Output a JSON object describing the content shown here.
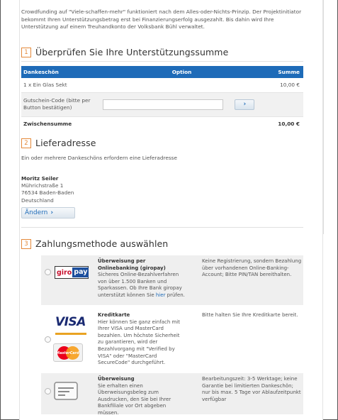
{
  "intro_text": "Crowdfunding auf \"Viele-schaffen-mehr\" funktioniert nach dem Alles-oder-Nichts-Prinzip. Der Projektinitiator bekommt Ihren Unterstützungsbetrag erst bei Finanzierungserfolg ausgezahlt. Bis dahin wird Ihre Unterstützung auf einem Treuhandkonto der Volksbank Bühl verwaltet.",
  "sections": {
    "summary": {
      "number": "1",
      "title": "Überprüfen Sie Ihre Unterstützungssumme"
    },
    "delivery": {
      "number": "2",
      "title": "Lieferadresse"
    },
    "payment": {
      "number": "3",
      "title": "Zahlungsmethode auswählen"
    }
  },
  "summary_table": {
    "headers": [
      "Dankeschön",
      "Option",
      "Summe"
    ],
    "item": {
      "label": "1 x Ein Glas Sekt",
      "amount": "10,00 €"
    },
    "voucher": {
      "label": "Gutschein-Code (bitte per Button bestätigen)",
      "value": "",
      "button": "›"
    },
    "subtotal": {
      "label": "Zwischensumme",
      "amount": "10,00 €"
    }
  },
  "delivery": {
    "note": "Ein oder mehrere Dankeschöns erfordern eine Lieferadresse",
    "name": "Moritz Seiler",
    "street": "Mührichstraße 1",
    "city": "76534 Baden-Baden",
    "country": "Deutschland",
    "change_button": "Ändern",
    "change_chevron": "›"
  },
  "payment_methods": [
    {
      "logo_text_1": "giro",
      "logo_text_2": "pay",
      "title": "Überweisung per Onlinebanking (giropay)",
      "description_pre": "Sicheres Online-Bezahlverfahren von über 1.500 Banken und Sparkassen. Ob Ihre Bank giropay unterstützt können Sie ",
      "link": "hier",
      "description_post": " prüfen.",
      "note": "Keine Registrierung, sondern Bezahlung über vorhandenen Online-Banking- Account; Bitte PIN/TAN bereithalten."
    },
    {
      "logo_visa": "VISA",
      "logo_mc": "MasterCard",
      "title": "Kreditkarte",
      "description": "Hier können Sie ganz einfach mit Ihrer VISA und MasterCard bezahlen. Um höchste Sicherheit zu garantieren, wird der Bezahlvorgang mit \"Verified by VISA\" oder \"MasterCard SecureCode\" durchgeführt.",
      "note": "Bitte halten Sie Ihre Kreditkarte bereit."
    },
    {
      "title": "Überweisung",
      "description": "Sie erhalten einen Überweisungsbeleg zum Ausdrucken, den Sie bei Ihrer Bankfiliale vor Ort abgeben müssen.",
      "note": "Bearbeitungszeit: 3-5 Werktage; keine Garantie bei limitierten Dankeschön; nur bis max. 5 Tage vor Ablaufzeitpunkt verfügbar"
    }
  ],
  "colors": {
    "accent_orange": "#e4893a",
    "brand_blue": "#1e6bb8"
  }
}
